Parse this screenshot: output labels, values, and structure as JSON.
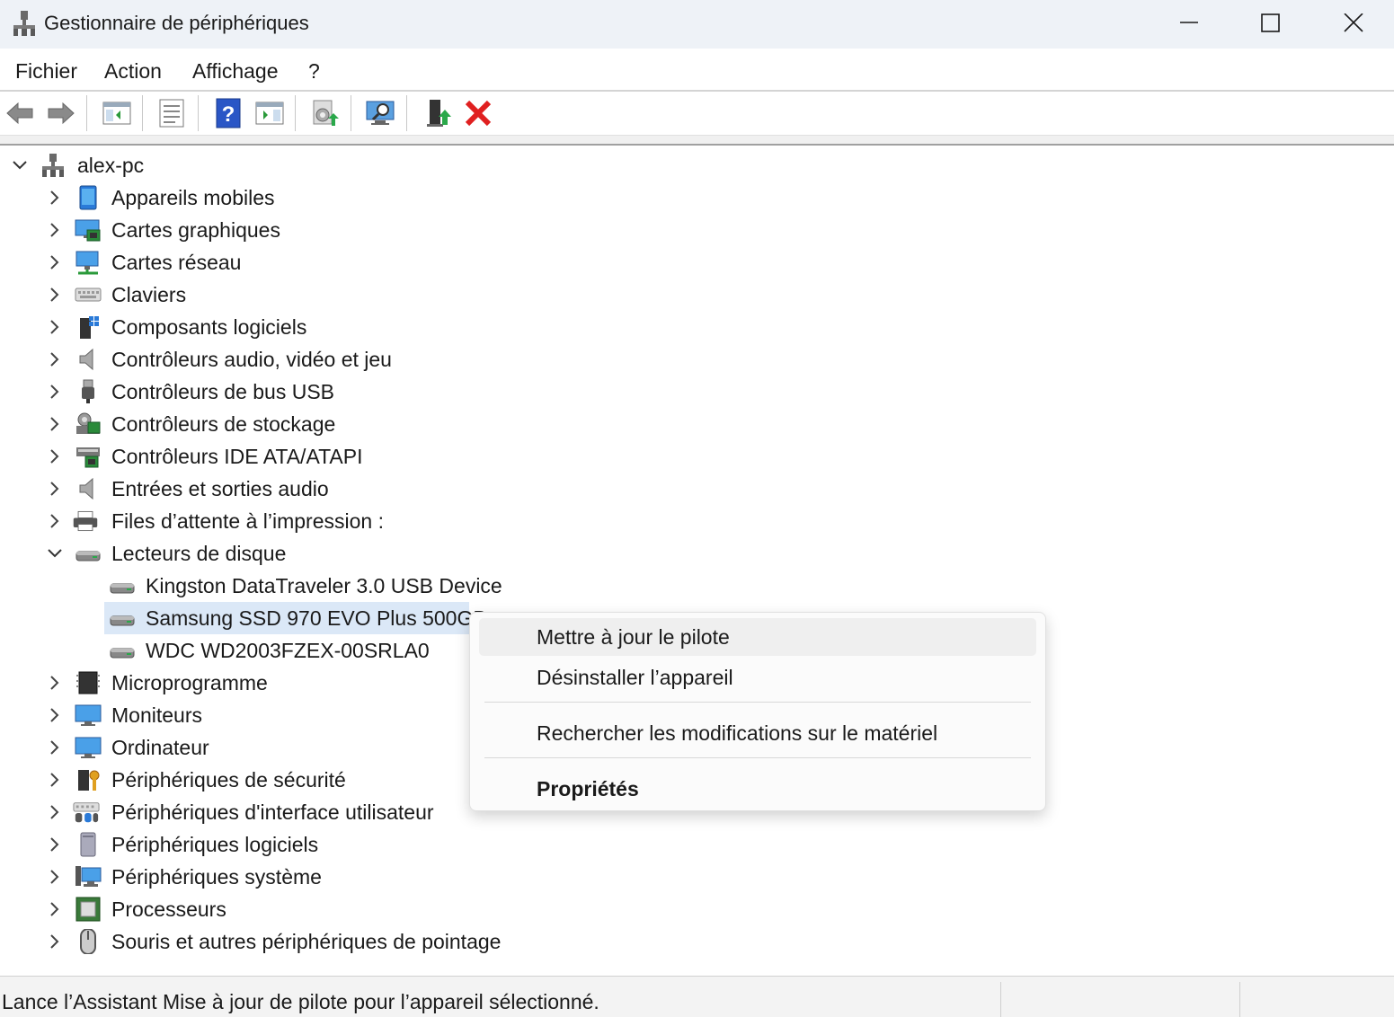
{
  "window": {
    "title": "Gestionnaire de périphériques"
  },
  "menu": {
    "items": [
      "Fichier",
      "Action",
      "Affichage",
      "?"
    ]
  },
  "toolbar": {
    "buttons": [
      "back-icon",
      "forward-icon",
      "show-hide-tree-icon",
      "properties-icon",
      "help-icon",
      "view-icon",
      "update-driver-icon",
      "scan-hardware-icon",
      "add-device-icon",
      "uninstall-icon"
    ]
  },
  "tree": {
    "root": "alex-pc",
    "categories": [
      "Appareils mobiles",
      "Cartes graphiques",
      "Cartes réseau",
      "Claviers",
      "Composants logiciels",
      "Contrôleurs audio, vidéo et jeu",
      "Contrôleurs de bus USB",
      "Contrôleurs de stockage",
      "Contrôleurs IDE ATA/ATAPI",
      "Entrées et sorties audio",
      "Files d’attente à l’impression :",
      "Lecteurs de disque",
      "Microprogramme",
      "Moniteurs",
      "Ordinateur",
      "Périphériques de sécurité",
      "Périphériques d'interface utilisateur",
      "Périphériques logiciels",
      "Périphériques système",
      "Processeurs",
      "Souris et autres périphériques de pointage"
    ],
    "disk_drives": [
      "Kingston DataTraveler 3.0 USB Device",
      "Samsung SSD 970 EVO Plus 500GB",
      "WDC WD2003FZEX-00SRLA0"
    ]
  },
  "context_menu": {
    "update_driver": "Mettre à jour le pilote",
    "uninstall_device": "Désinstaller l’appareil",
    "scan_hardware": "Rechercher les modifications sur le matériel",
    "properties": "Propriétés"
  },
  "status": {
    "text": "Lance l’Assistant Mise à jour de pilote pour l’appareil sélectionné."
  },
  "colors": {
    "selection": "#dbe8f7",
    "uninstall_red": "#e02020",
    "help_blue": "#2a56c6"
  }
}
